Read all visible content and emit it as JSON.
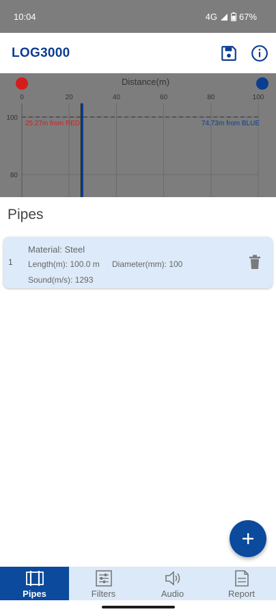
{
  "status_bar": {
    "time": "10:04",
    "network": "4G",
    "battery": "67%"
  },
  "app_bar": {
    "title": "LOG3000",
    "save_icon": "save-icon",
    "info_icon": "info-circle-icon"
  },
  "chart": {
    "title": "Distance(m)",
    "x_ticks": [
      "0",
      "20",
      "40",
      "60",
      "80",
      "100"
    ],
    "y_ticks": [
      "100",
      "80"
    ],
    "red_label": "25.27m from RED",
    "blue_label": "74.73m from BLUE",
    "colors": {
      "red": "#d41d1d",
      "blue": "#0b3d91",
      "background": "#7d7d7d"
    }
  },
  "chart_data": {
    "type": "line",
    "title": "Distance(m)",
    "xlim": [
      0,
      100
    ],
    "ylim": [
      75,
      100
    ],
    "x_ticks": [
      0,
      20,
      40,
      60,
      80,
      100
    ],
    "y_ticks": [
      100,
      80
    ],
    "markers": [
      {
        "name": "RED",
        "x": 0,
        "color": "#d41d1d"
      },
      {
        "name": "BLUE",
        "x": 100,
        "color": "#0b3d91"
      }
    ],
    "leak_position": 25.27,
    "annotations": [
      "25.27m from RED",
      "74.73m from BLUE"
    ],
    "threshold": 100
  },
  "pipes": {
    "heading": "Pipes",
    "items": [
      {
        "index": "1",
        "material": "Material: Steel",
        "length": "Length(m): 100.0 m",
        "diameter": "Diameter(mm): 100",
        "sound": "Sound(m/s): 1293"
      }
    ]
  },
  "fab": {
    "icon": "plus-icon"
  },
  "bottom_nav": {
    "items": [
      {
        "label": "Pipes",
        "icon": "pipe-icon",
        "active": true
      },
      {
        "label": "Filters",
        "icon": "filters-icon",
        "active": false
      },
      {
        "label": "Audio",
        "icon": "speaker-icon",
        "active": false
      },
      {
        "label": "Report",
        "icon": "report-icon",
        "active": false
      }
    ]
  }
}
